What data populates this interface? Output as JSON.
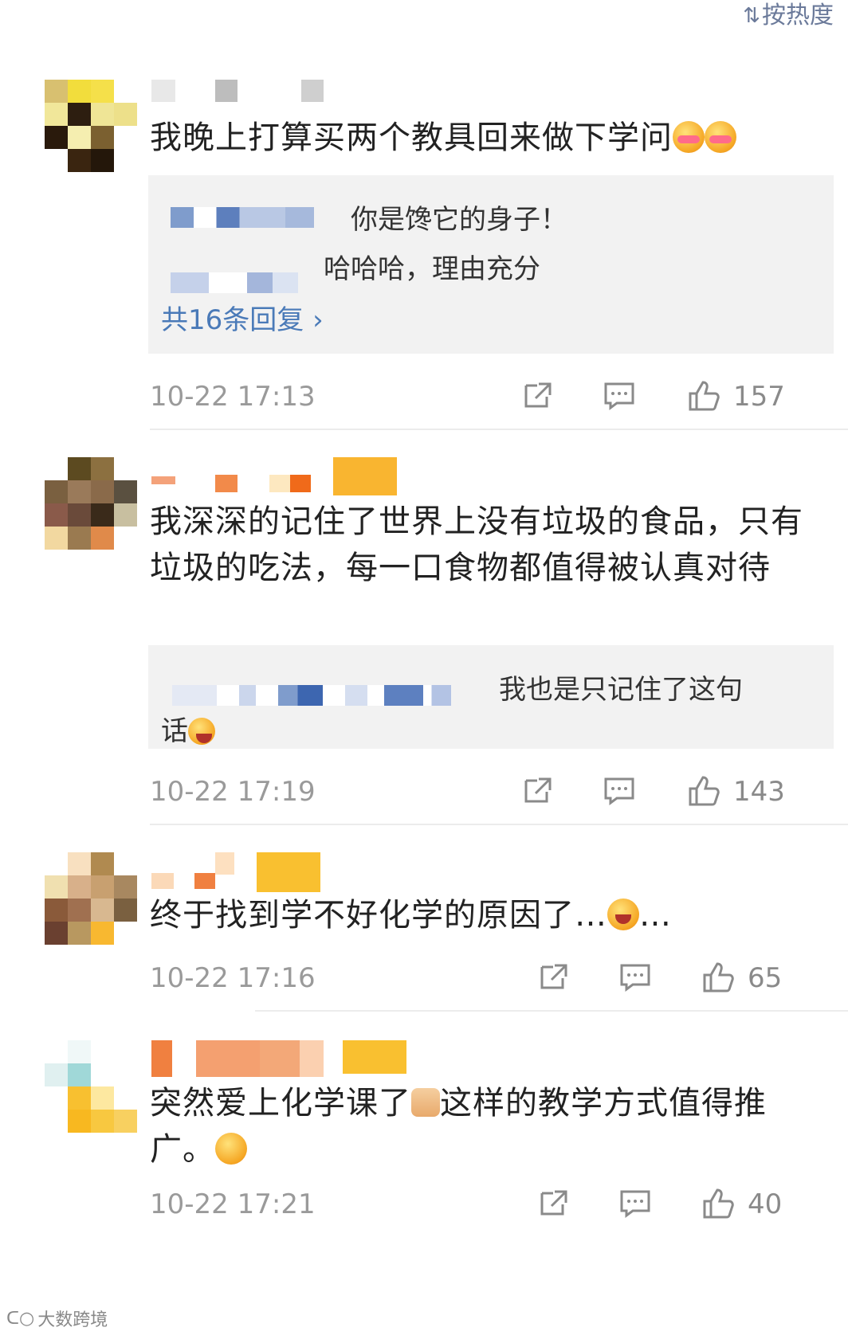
{
  "sort": {
    "label": "按热度",
    "icon": "sort-arrows-icon"
  },
  "comments": [
    {
      "text": "我晚上打算买两个教具回来做下学问",
      "emoji_after": "drooling-face-icon",
      "replies": [
        {
          "text": "你是馋它的身子！"
        },
        {
          "text": "哈哈哈，理由充分"
        }
      ],
      "more_replies": "共16条回复 ›",
      "time": "10-22 17:13",
      "likes": "157"
    },
    {
      "text": "我深深的记住了世界上没有垃圾的食品，只有垃圾的吃法，每一口食物都值得被认真对待",
      "replies": [
        {
          "text": "我也是只记住了这句",
          "text2": "话"
        }
      ],
      "time": "10-22 17:19",
      "likes": "143"
    },
    {
      "text": "终于找到学不好化学的原因了…",
      "text_after": "…",
      "time": "10-22 17:16",
      "likes": "65"
    },
    {
      "text": "突然爱上化学课了",
      "text_mid": "这样的教学方式值得推广。",
      "time": "10-22 17:21",
      "likes": "40"
    }
  ],
  "watermark": "大数跨境",
  "colors": {
    "link": "#4a7ab8",
    "meta": "#9a9a9a",
    "reply_bg": "#f2f2f2"
  }
}
